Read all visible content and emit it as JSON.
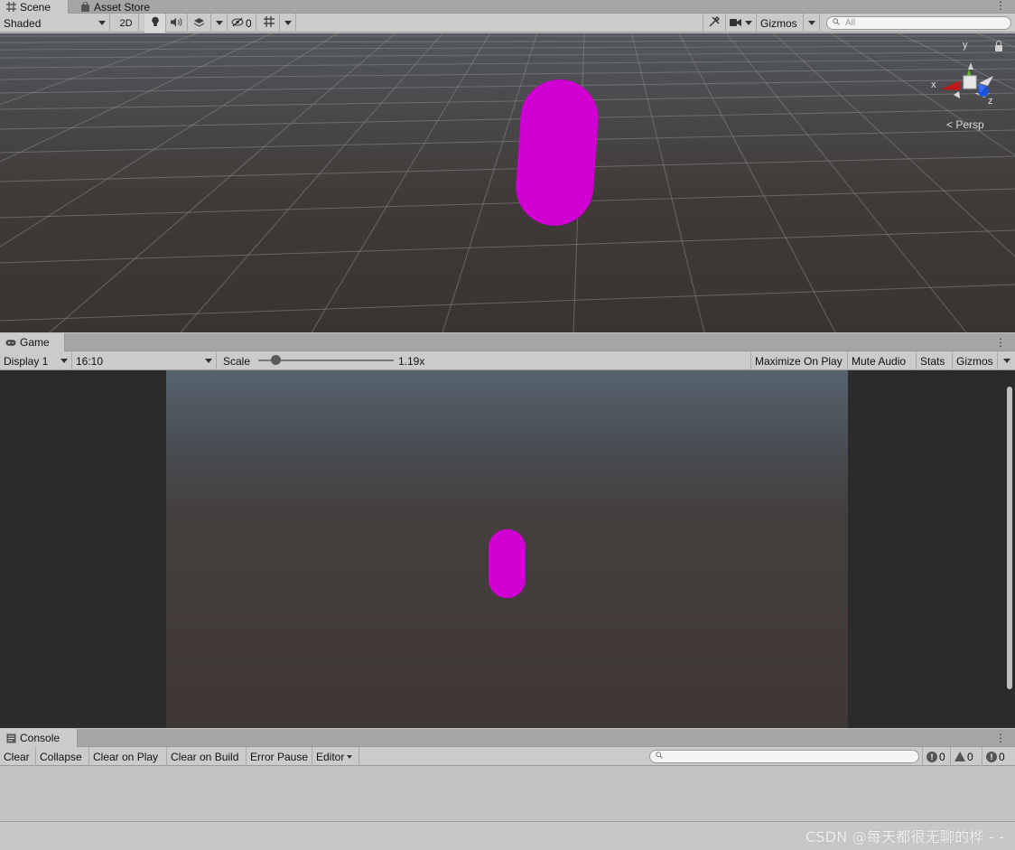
{
  "scene": {
    "tabs": [
      {
        "label": "Scene",
        "icon": "grid-icon"
      },
      {
        "label": "Asset Store",
        "icon": "shopping-bag-icon"
      }
    ],
    "toolbar": {
      "draw_mode": "Shaded",
      "mode_2d": "2D",
      "hidden_count": "0",
      "gizmos_label": "Gizmos",
      "search_placeholder": "All"
    },
    "gizmo_axes": {
      "x": "x",
      "y": "y",
      "z": "z"
    },
    "projection_label": "Persp",
    "colors": {
      "capsule": "#d100d2",
      "x_axis": "#c01818",
      "y_axis": "#5cbf1a",
      "z_axis": "#1e52d9"
    }
  },
  "game": {
    "tab_label": "Game",
    "toolbar": {
      "display": "Display 1",
      "aspect": "16:10",
      "scale_label": "Scale",
      "scale_value": "1.19x",
      "scale_slider_fraction": 0.12,
      "maximize": "Maximize On Play",
      "mute": "Mute Audio",
      "stats": "Stats",
      "gizmos": "Gizmos"
    }
  },
  "console": {
    "tab_label": "Console",
    "toolbar": {
      "clear": "Clear",
      "collapse": "Collapse",
      "clear_on_play": "Clear on Play",
      "clear_on_build": "Clear on Build",
      "error_pause": "Error Pause",
      "editor": "Editor"
    },
    "counts": {
      "info": "0",
      "warnings": "0",
      "errors": "0"
    }
  },
  "watermark": "CSDN @每天都很无聊的桦 - -"
}
